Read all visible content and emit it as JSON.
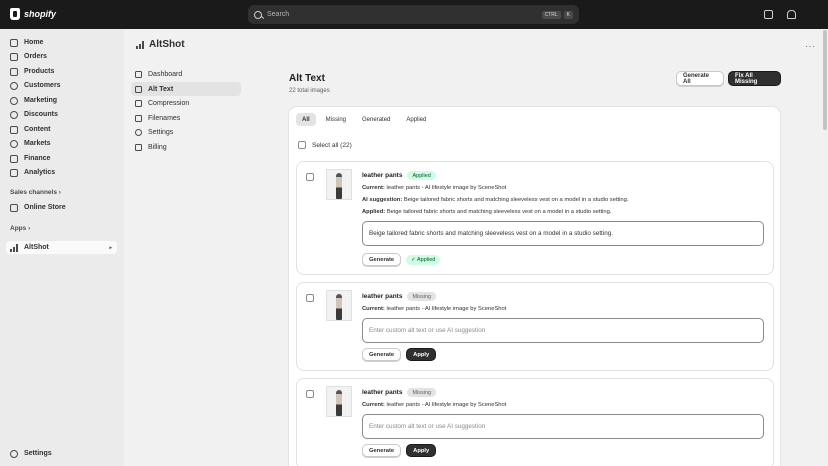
{
  "topbar": {
    "brand": "shopify",
    "search_placeholder": "Search",
    "shortcut_keys": [
      "CTRL",
      "K"
    ]
  },
  "sidebar": {
    "items": [
      {
        "label": "Home",
        "icon": "home-icon"
      },
      {
        "label": "Orders",
        "icon": "orders-icon"
      },
      {
        "label": "Products",
        "icon": "tag-icon"
      },
      {
        "label": "Customers",
        "icon": "person-icon"
      },
      {
        "label": "Marketing",
        "icon": "target-icon"
      },
      {
        "label": "Discounts",
        "icon": "discount-icon"
      },
      {
        "label": "Content",
        "icon": "content-icon"
      },
      {
        "label": "Markets",
        "icon": "globe-icon"
      },
      {
        "label": "Finance",
        "icon": "bank-icon"
      },
      {
        "label": "Analytics",
        "icon": "chart-icon"
      }
    ],
    "sales_channels_label": "Sales channels",
    "online_store": "Online Store",
    "apps_label": "Apps",
    "app_name": "AltShot",
    "settings": "Settings"
  },
  "app": {
    "title": "AltShot",
    "subnav": [
      {
        "label": "Dashboard"
      },
      {
        "label": "Alt Text"
      },
      {
        "label": "Compression"
      },
      {
        "label": "Filenames"
      },
      {
        "label": "Settings"
      },
      {
        "label": "Billing"
      }
    ]
  },
  "page": {
    "title": "Alt Text",
    "subtitle": "22 total images",
    "generate_all": "Generate All",
    "fix_all_missing": "Fix All Missing",
    "tabs": [
      "All",
      "Missing",
      "Generated",
      "Applied"
    ],
    "select_all": "Select all (22)"
  },
  "items": [
    {
      "name": "leather pants",
      "status": "Applied",
      "current_label": "Current:",
      "current": "leather pants - AI lifestyle image by SceneShot",
      "ai_label": "AI suggestion:",
      "ai_suggestion": "Beige tailored fabric shorts and matching sleeveless vest on a model in a studio setting.",
      "applied_label": "Applied:",
      "applied": "Beige tailored fabric shorts and matching sleeveless vest on a model in a studio setting.",
      "field_value": "Beige tailored fabric shorts and matching sleeveless vest on a model in a studio setting.",
      "generate": "Generate",
      "applied_tag": "✓ Applied"
    },
    {
      "name": "leather pants",
      "status": "Missing",
      "current_label": "Current:",
      "current": "leather pants - AI lifestyle image by SceneShot",
      "placeholder": "Enter custom alt text or use AI suggestion",
      "generate": "Generate",
      "apply": "Apply"
    },
    {
      "name": "leather pants",
      "status": "Missing",
      "current_label": "Current:",
      "current": "leather pants - AI lifestyle image by SceneShot",
      "placeholder": "Enter custom alt text or use AI suggestion",
      "generate": "Generate",
      "apply": "Apply"
    }
  ]
}
